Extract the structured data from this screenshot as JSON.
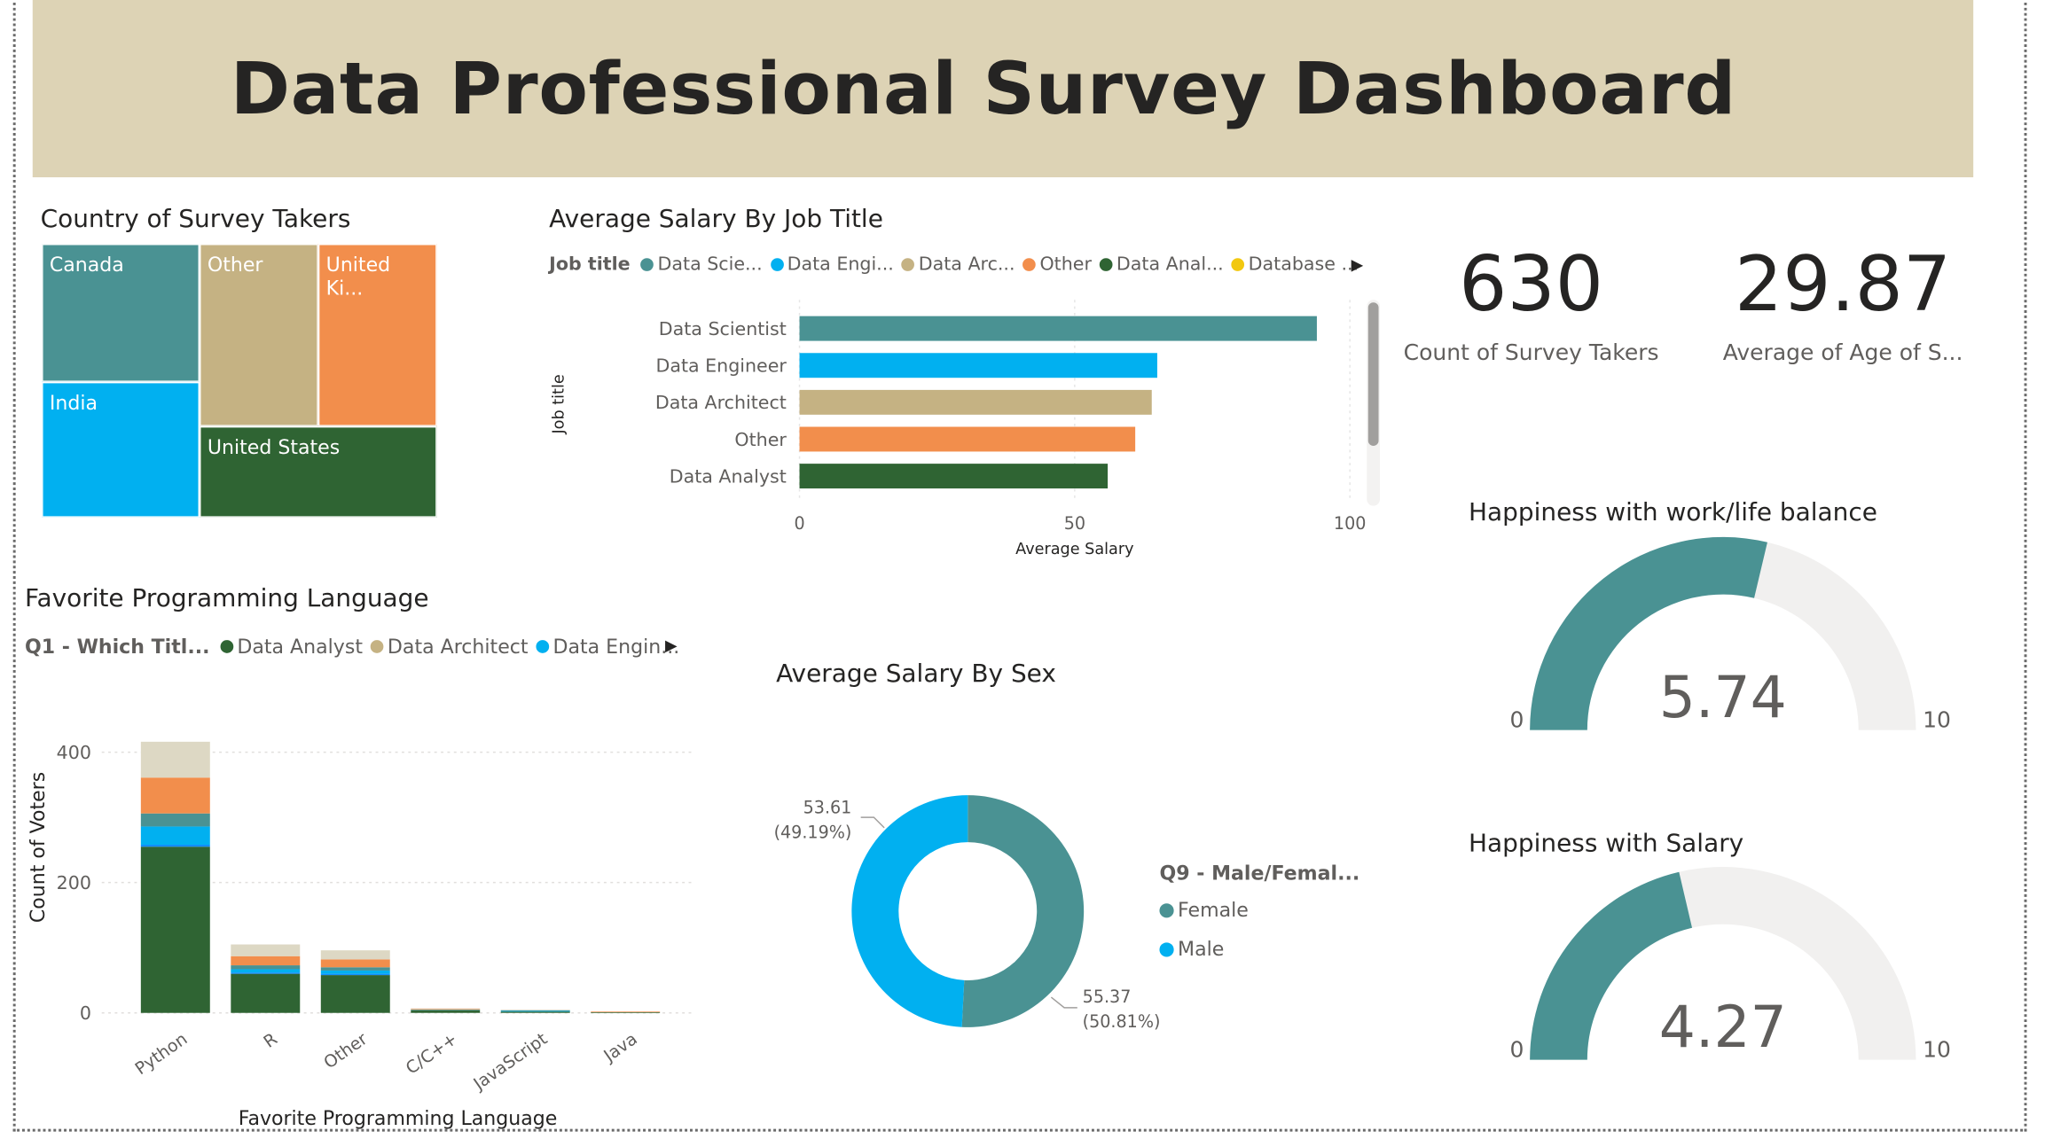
{
  "header": {
    "title": "Data Professional Survey Dashboard"
  },
  "treemap": {
    "title": "Country of Survey Takers",
    "tiles": [
      {
        "label": "Canada",
        "color": "#4a9293"
      },
      {
        "label": "Other",
        "color": "#c5b283"
      },
      {
        "label": "United Ki...",
        "color": "#f28e4c"
      },
      {
        "label": "India",
        "color": "#01b0f0"
      },
      {
        "label": "United States",
        "color": "#2f6433"
      }
    ]
  },
  "salary_job": {
    "title": "Average Salary By Job Title",
    "legend_title": "Job title",
    "legend": [
      {
        "label": "Data Scie...",
        "color": "#4a9293"
      },
      {
        "label": "Data Engi...",
        "color": "#01b0f0"
      },
      {
        "label": "Data Arc...",
        "color": "#c5b283"
      },
      {
        "label": "Other",
        "color": "#f28e4c"
      },
      {
        "label": "Data Anal...",
        "color": "#2f6433"
      },
      {
        "label": "Database ...",
        "color": "#f2c80f"
      }
    ]
  },
  "cards": [
    {
      "value": "630",
      "label": "Count of Survey Takers"
    },
    {
      "value": "29.87",
      "label": "Average of Age of S..."
    }
  ],
  "gauges": [
    {
      "title": "Happiness with work/life balance",
      "value": 5.74,
      "value_text": "5.74",
      "min": "0",
      "max": "10"
    },
    {
      "title": "Happiness with Salary",
      "value": 4.27,
      "value_text": "4.27",
      "min": "0",
      "max": "10"
    }
  ],
  "lang": {
    "title": "Favorite Programming Language",
    "legend_title": "Q1 - Which Titl...",
    "legend": [
      {
        "label": "Data Analyst",
        "color": "#2f6433"
      },
      {
        "label": "Data Architect",
        "color": "#c5b283"
      },
      {
        "label": "Data Engin...",
        "color": "#01b0f0"
      }
    ]
  },
  "sex": {
    "title": "Average Salary By Sex",
    "legend_title": "Q9 - Male/Femal...",
    "legend": [
      {
        "label": "Female",
        "color": "#4a9293"
      },
      {
        "label": "Male",
        "color": "#01b0f0"
      }
    ],
    "label_male_value": "53.61",
    "label_male_pct": "(49.19%)",
    "label_female_value": "55.37",
    "label_female_pct": "(50.81%)"
  },
  "chart_data": [
    {
      "type": "bar",
      "orientation": "horizontal",
      "title": "Average Salary By Job Title",
      "xlabel": "Average Salary",
      "ylabel": "Job title",
      "categories": [
        "Data Scientist",
        "Data Engineer",
        "Data Architect",
        "Other",
        "Data Analyst"
      ],
      "values": [
        94,
        65,
        64,
        61,
        56
      ],
      "colors": [
        "#4a9293",
        "#01b0f0",
        "#c5b283",
        "#f28e4c",
        "#2f6433"
      ],
      "xlim": [
        0,
        100
      ],
      "xticks": [
        "0",
        "50",
        "100"
      ]
    },
    {
      "type": "bar",
      "stacked": true,
      "title": "Favorite Programming Language",
      "xlabel": "Favorite Programming Language",
      "ylabel": "Count of Voters",
      "categories": [
        "Python",
        "R",
        "Other",
        "C/C++",
        "JavaScript",
        "Java"
      ],
      "ylim": [
        0,
        420
      ],
      "yticks": [
        0,
        200,
        400
      ],
      "series": [
        {
          "name": "Data Analyst",
          "color": "#2f6433",
          "values": [
            255,
            60,
            58,
            4,
            2,
            1
          ]
        },
        {
          "color": "#118dff",
          "values": [
            3,
            2,
            2,
            0,
            0,
            0
          ]
        },
        {
          "name": "Data Engin...",
          "color": "#01b0f0",
          "values": [
            28,
            5,
            5,
            0,
            1,
            0
          ]
        },
        {
          "color": "#4a9293",
          "values": [
            20,
            6,
            5,
            1,
            1,
            0
          ]
        },
        {
          "color": "#f28e4c",
          "values": [
            55,
            14,
            12,
            1,
            0,
            1
          ]
        },
        {
          "name": "Data Architect",
          "color": "#ddd8c4",
          "values": [
            55,
            18,
            14,
            1,
            1,
            0
          ]
        }
      ]
    },
    {
      "type": "pie",
      "donut": true,
      "title": "Average Salary By Sex",
      "categories": [
        "Female",
        "Male"
      ],
      "values": [
        55.37,
        53.61
      ],
      "percent": [
        50.81,
        49.19
      ],
      "colors": [
        "#4a9293",
        "#01b0f0"
      ]
    }
  ]
}
